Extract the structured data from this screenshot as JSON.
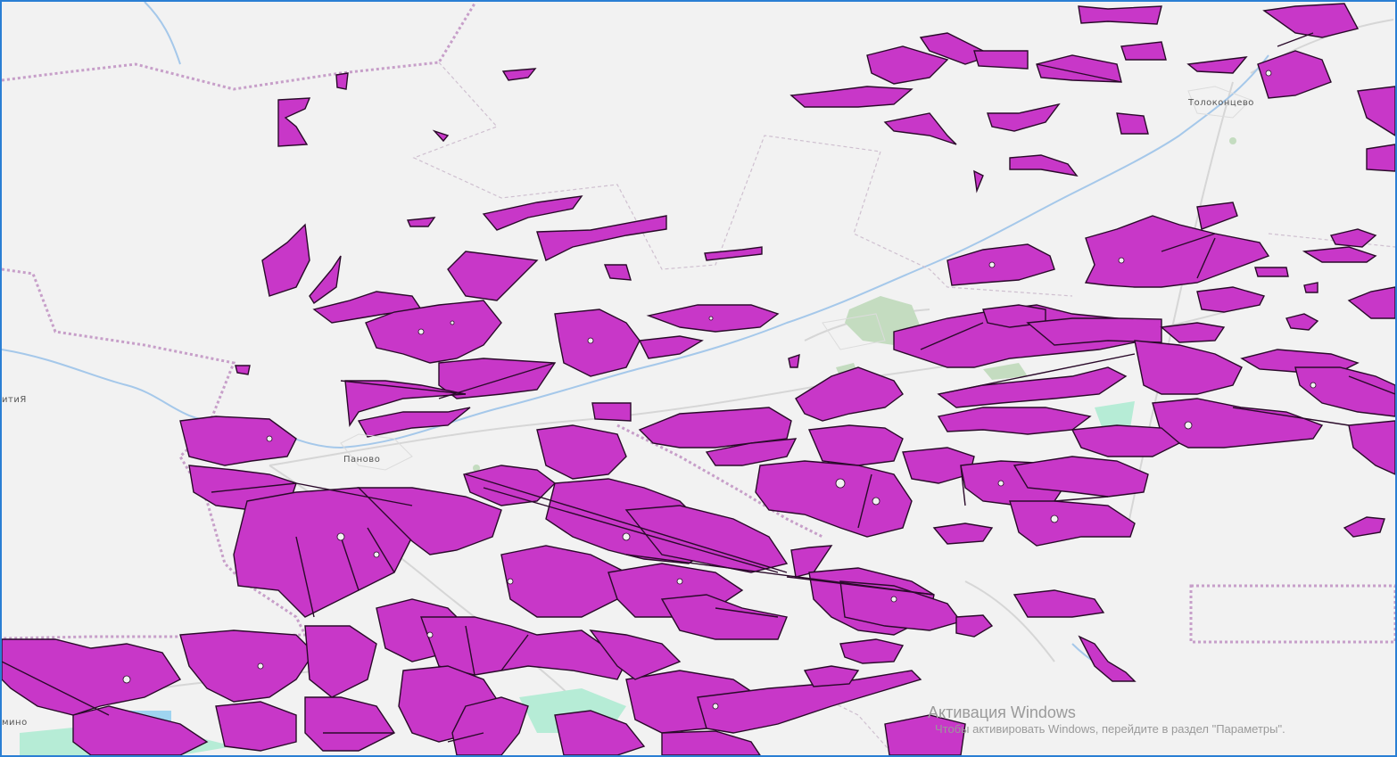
{
  "map": {
    "colors": {
      "background": "#f2f2f2",
      "parcel_fill": "#c837c8",
      "parcel_stroke": "#2a0a2a",
      "boundary": "#c79fc9",
      "river": "#a5c8ea",
      "road": "#d8d8d8",
      "forest": "#c4dcc0",
      "wetland": "#b6ecd6",
      "frame": "#2a7fd4"
    },
    "labels": {
      "panovo": "Паново",
      "tolokontsevo": "Толоконцево",
      "left_edge_top": "итиЯ",
      "left_edge_bottom": "мино"
    }
  },
  "watermark": {
    "title": "Активация Windows",
    "subtitle": "Чтобы активировать Windows, перейдите в раздел \"Параметры\"."
  }
}
